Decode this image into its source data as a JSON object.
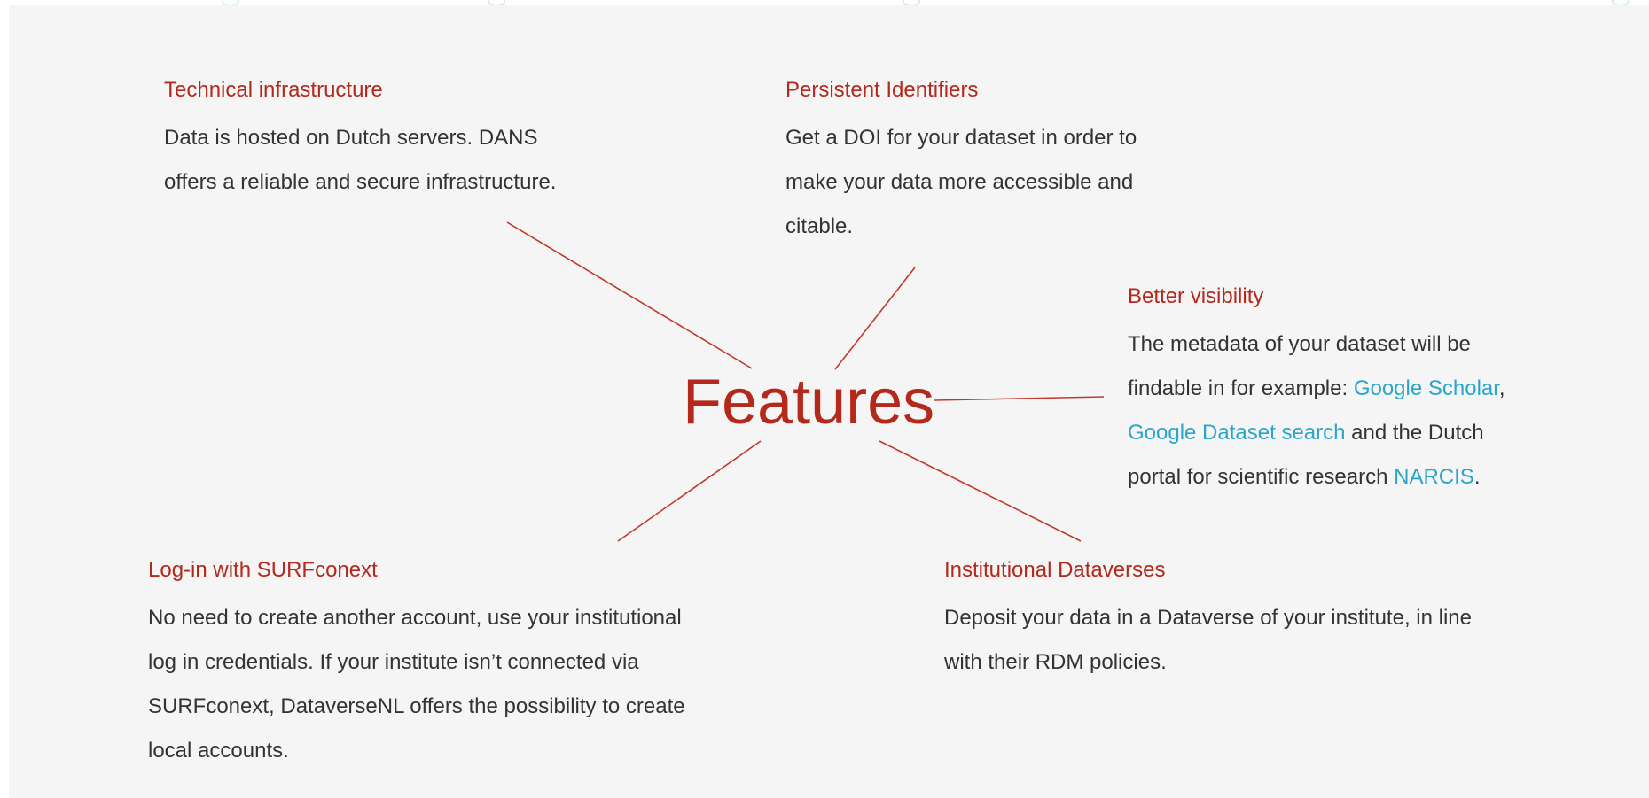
{
  "colors": {
    "heading": "#b5281c",
    "text": "#333333",
    "link": "#2ba6cb",
    "background": "#f5f5f5",
    "connector": "#c0392b"
  },
  "center_title": "Features",
  "features": {
    "technical": {
      "title": "Technical infrastructure",
      "line1": "Data is hosted on Dutch servers. DANS",
      "line2": "offers a reliable and secure infrastructure."
    },
    "pid": {
      "title": "Persistent Identifiers",
      "line1": "Get a DOI for your dataset in order to",
      "line2": "make your data more accessible and",
      "line3": "citable."
    },
    "visibility": {
      "title": "Better visibility",
      "line1": "The metadata of your dataset will be",
      "line2_text": "findable in for example: ",
      "link_scholar": "Google Scholar",
      "comma": ",",
      "link_dataset": "Google Dataset search",
      "line3_text": " and the Dutch",
      "line4_text": "portal for scientific research ",
      "link_narcis": "NARCIS",
      "period": "."
    },
    "login": {
      "title": "Log-in with SURFconext",
      "line1": "No need to create another account, use your institutional",
      "line2": "log in credentials. If your institute isn’t connected via",
      "line3": "SURFconext, DataverseNL offers the possibility to create",
      "line4": "local accounts."
    },
    "dataverses": {
      "title": "Institutional Dataverses",
      "line1": "Deposit your data in a Dataverse of your institute, in line",
      "line2": "with their RDM policies."
    }
  }
}
